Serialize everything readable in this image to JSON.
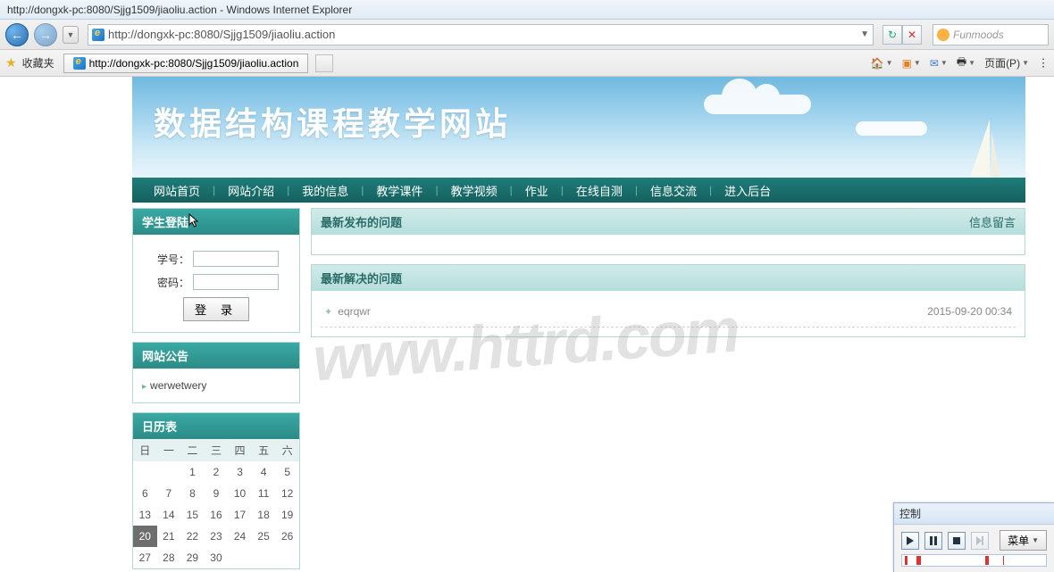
{
  "window": {
    "title": "http://dongxk-pc:8080/Sjjg1509/jiaoliu.action - Windows Internet Explorer"
  },
  "address": {
    "url": "http://dongxk-pc:8080/Sjjg1509/jiaoliu.action"
  },
  "search": {
    "placeholder": "Funmoods"
  },
  "favbar": {
    "favorites_label": "收藏夹",
    "tab_title": "http://dongxk-pc:8080/Sjjg1509/jiaoliu.action",
    "page_menu": "页面(P)"
  },
  "banner": {
    "title": "数据结构课程教学网站"
  },
  "menu": {
    "items": [
      "网站首页",
      "网站介绍",
      "我的信息",
      "教学课件",
      "教学视频",
      "作业",
      "在线自测",
      "信息交流",
      "进入后台"
    ]
  },
  "login": {
    "header": "学生登陆",
    "id_label": "学号：",
    "pw_label": "密码：",
    "submit": "登 录"
  },
  "notice": {
    "header": "网站公告",
    "items": [
      "werwetwery"
    ]
  },
  "calendar": {
    "header": "日历表",
    "weekdays": [
      "日",
      "一",
      "二",
      "三",
      "四",
      "五",
      "六"
    ],
    "rows": [
      [
        "",
        "",
        "",
        "1",
        "2",
        "3",
        "4",
        "5"
      ],
      [
        "6",
        "7",
        "8",
        "9",
        "10",
        "11",
        "12"
      ],
      [
        "13",
        "14",
        "15",
        "16",
        "17",
        "18",
        "19"
      ],
      [
        "20",
        "21",
        "22",
        "23",
        "24",
        "25",
        "26"
      ],
      [
        "27",
        "28",
        "29",
        "30",
        "",
        "",
        ""
      ]
    ],
    "current": "20"
  },
  "posts": {
    "latest_header": "最新发布的问题",
    "latest_link": "信息留言",
    "solved_header": "最新解决的问题",
    "solved": [
      {
        "title": "eqrqwr",
        "time": "2015-09-20 00:34"
      }
    ]
  },
  "watermark": "www.httrd.com",
  "control": {
    "header": "控制",
    "menu": "菜单"
  }
}
